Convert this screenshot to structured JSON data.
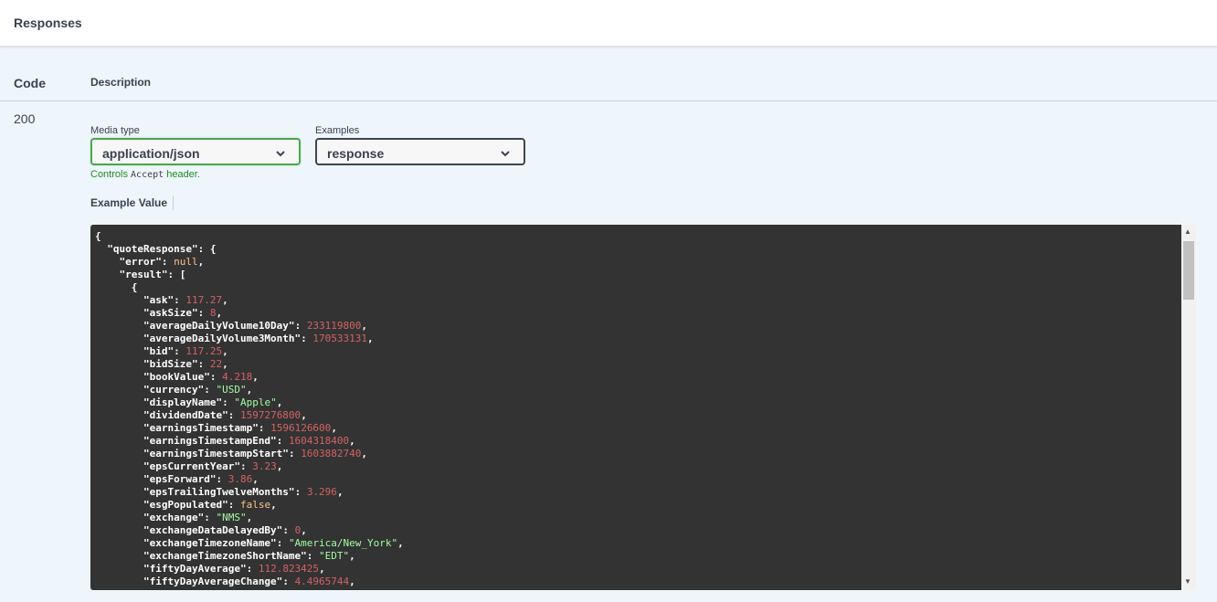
{
  "responses": {
    "title": "Responses",
    "col_code": "Code",
    "col_desc": "Description",
    "status_code": "200",
    "media_type_label": "Media type",
    "media_type_value": "application/json",
    "examples_label": "Examples",
    "examples_value": "response",
    "controls_prefix": "Controls ",
    "controls_code": "Accept",
    "controls_suffix": " header.",
    "example_value_tab": "Example Value",
    "colors": {
      "media_select_border": "#49a64b",
      "code_bg": "#333333",
      "number": "#d36363",
      "string": "#a2fca2",
      "literal": "#fcc28c"
    },
    "icons": [
      "chevron-down-icon",
      "scroll-up-arrow-icon",
      "scroll-down-arrow-icon"
    ]
  },
  "json_lines": [
    {
      "indent": "",
      "key": "",
      "value": "{",
      "type": "p",
      "tail": ""
    },
    {
      "indent": "  ",
      "key": "\"quoteResponse\"",
      "value": "{",
      "type": "p",
      "tail": ""
    },
    {
      "indent": "    ",
      "key": "\"error\"",
      "value": "null",
      "type": "l",
      "tail": ","
    },
    {
      "indent": "    ",
      "key": "\"result\"",
      "value": "[",
      "type": "p",
      "tail": ""
    },
    {
      "indent": "      ",
      "key": "",
      "value": "{",
      "type": "p",
      "tail": ""
    },
    {
      "indent": "        ",
      "key": "\"ask\"",
      "value": "117.27",
      "type": "n",
      "tail": ","
    },
    {
      "indent": "        ",
      "key": "\"askSize\"",
      "value": "8",
      "type": "n",
      "tail": ","
    },
    {
      "indent": "        ",
      "key": "\"averageDailyVolume10Day\"",
      "value": "233119800",
      "type": "n",
      "tail": ","
    },
    {
      "indent": "        ",
      "key": "\"averageDailyVolume3Month\"",
      "value": "170533131",
      "type": "n",
      "tail": ","
    },
    {
      "indent": "        ",
      "key": "\"bid\"",
      "value": "117.25",
      "type": "n",
      "tail": ","
    },
    {
      "indent": "        ",
      "key": "\"bidSize\"",
      "value": "22",
      "type": "n",
      "tail": ","
    },
    {
      "indent": "        ",
      "key": "\"bookValue\"",
      "value": "4.218",
      "type": "n",
      "tail": ","
    },
    {
      "indent": "        ",
      "key": "\"currency\"",
      "value": "\"USD\"",
      "type": "s",
      "tail": ","
    },
    {
      "indent": "        ",
      "key": "\"displayName\"",
      "value": "\"Apple\"",
      "type": "s",
      "tail": ","
    },
    {
      "indent": "        ",
      "key": "\"dividendDate\"",
      "value": "1597276800",
      "type": "n",
      "tail": ","
    },
    {
      "indent": "        ",
      "key": "\"earningsTimestamp\"",
      "value": "1596126600",
      "type": "n",
      "tail": ","
    },
    {
      "indent": "        ",
      "key": "\"earningsTimestampEnd\"",
      "value": "1604318400",
      "type": "n",
      "tail": ","
    },
    {
      "indent": "        ",
      "key": "\"earningsTimestampStart\"",
      "value": "1603882740",
      "type": "n",
      "tail": ","
    },
    {
      "indent": "        ",
      "key": "\"epsCurrentYear\"",
      "value": "3.23",
      "type": "n",
      "tail": ","
    },
    {
      "indent": "        ",
      "key": "\"epsForward\"",
      "value": "3.86",
      "type": "n",
      "tail": ","
    },
    {
      "indent": "        ",
      "key": "\"epsTrailingTwelveMonths\"",
      "value": "3.296",
      "type": "n",
      "tail": ","
    },
    {
      "indent": "        ",
      "key": "\"esgPopulated\"",
      "value": "false",
      "type": "l",
      "tail": ","
    },
    {
      "indent": "        ",
      "key": "\"exchange\"",
      "value": "\"NMS\"",
      "type": "s",
      "tail": ","
    },
    {
      "indent": "        ",
      "key": "\"exchangeDataDelayedBy\"",
      "value": "0",
      "type": "n",
      "tail": ","
    },
    {
      "indent": "        ",
      "key": "\"exchangeTimezoneName\"",
      "value": "\"America/New_York\"",
      "type": "s",
      "tail": ","
    },
    {
      "indent": "        ",
      "key": "\"exchangeTimezoneShortName\"",
      "value": "\"EDT\"",
      "type": "s",
      "tail": ","
    },
    {
      "indent": "        ",
      "key": "\"fiftyDayAverage\"",
      "value": "112.823425",
      "type": "n",
      "tail": ","
    },
    {
      "indent": "        ",
      "key": "\"fiftyDayAverageChange\"",
      "value": "4.4965744",
      "type": "n",
      "tail": ","
    }
  ]
}
